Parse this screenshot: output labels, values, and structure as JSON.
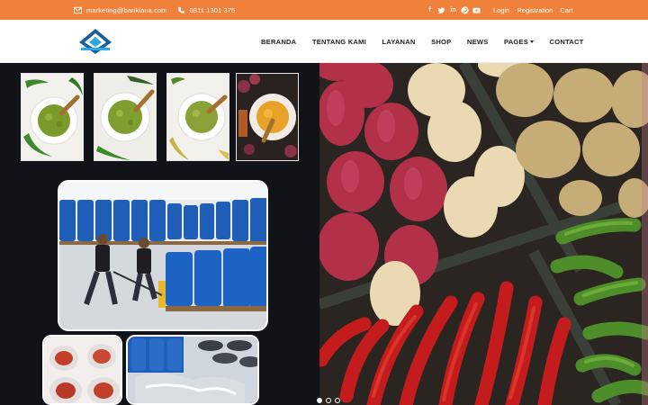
{
  "topbar": {
    "email": "marketing@barikiana.com",
    "phone": "0811 1301 375",
    "social_icons": [
      "facebook-icon",
      "twitter-icon",
      "linkedin-icon",
      "pinterest-icon",
      "youtube-icon"
    ],
    "links": [
      "Login",
      "Registration",
      "Cart"
    ],
    "background": "#f0813a"
  },
  "header": {
    "logo_colors": [
      "#1b5e9c",
      "#29a9e0"
    ],
    "nav": [
      {
        "label": "BERANDA"
      },
      {
        "label": "TENTANG KAMI"
      },
      {
        "label": "LAYANAN"
      },
      {
        "label": "SHOP"
      },
      {
        "label": "NEWS"
      },
      {
        "label": "PAGES",
        "has_dropdown": true
      },
      {
        "label": "CONTACT"
      }
    ]
  },
  "hero": {
    "slider_dots": 3,
    "active_dot": 0
  }
}
